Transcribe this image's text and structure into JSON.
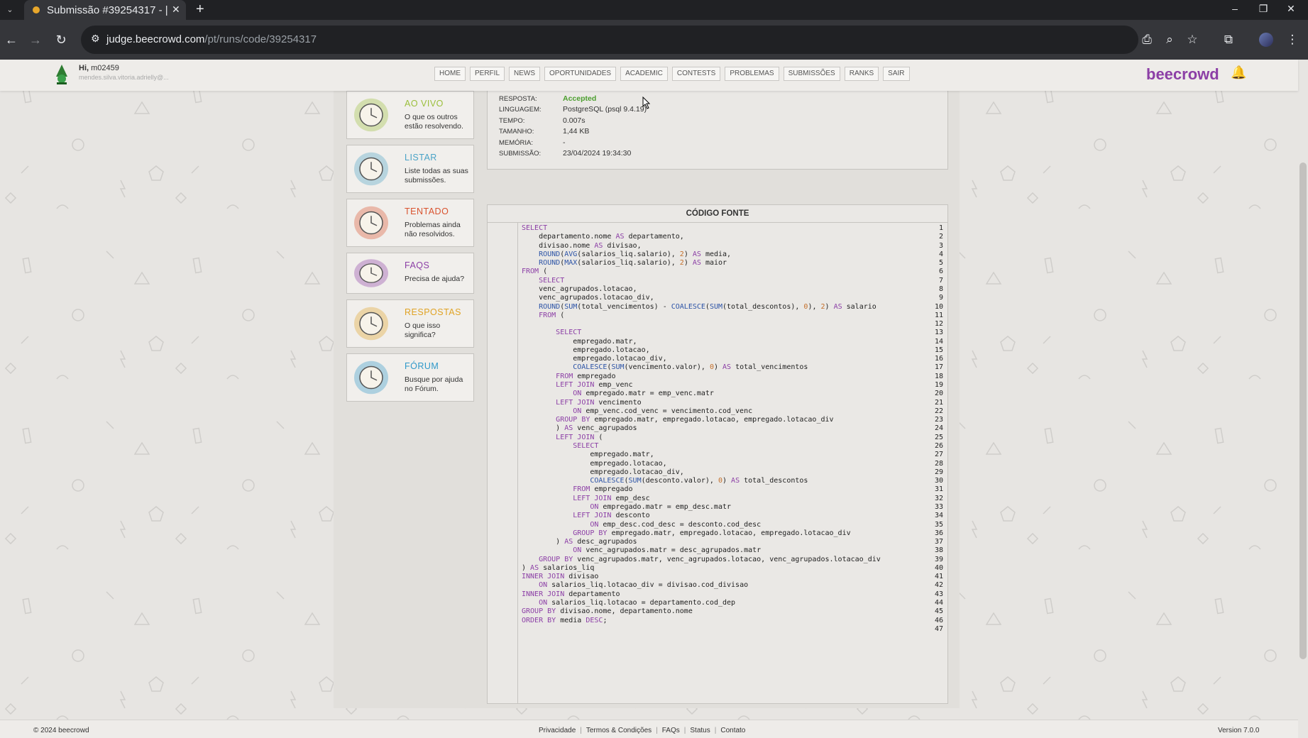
{
  "browser": {
    "tab_title": "Submissão #39254317 - |",
    "new_tab": "+",
    "url_host": "judge.beecrowd.com",
    "url_path": "/pt/runs/code/39254317"
  },
  "header": {
    "greeting": "Hi,",
    "username": "m02459",
    "email": "mendes.silva.vitoria.adrielly@...",
    "nav": [
      "HOME",
      "PERFIL",
      "NEWS",
      "OPORTUNIDADES",
      "ACADEMIC",
      "CONTESTS",
      "PROBLEMAS",
      "SUBMISSÕES",
      "RANKS",
      "SAIR"
    ],
    "brand": "beecrowd"
  },
  "sidebar": [
    {
      "title": "AO VIVO",
      "desc": "O que os outros estão resolvendo.",
      "color": "#9bbf3b",
      "icon": "globe-clock-icon"
    },
    {
      "title": "LISTAR",
      "desc": "Liste todas as suas submissões.",
      "color": "#4aa3c7",
      "icon": "papers-icon"
    },
    {
      "title": "TENTADO",
      "desc": "Problemas ainda não resolvidos.",
      "color": "#d9532f",
      "icon": "burning-box-icon"
    },
    {
      "title": "FAQS",
      "desc": "Precisa de ajuda?",
      "color": "#8c3fa6",
      "icon": "question-icon"
    },
    {
      "title": "RESPOSTAS",
      "desc": "O que isso significa?",
      "color": "#e0a324",
      "icon": "lightbulb-icon"
    },
    {
      "title": "FÓRUM",
      "desc": "Busque por ajuda no Fórum.",
      "color": "#2f98c9",
      "icon": "forum-icon"
    }
  ],
  "submission": {
    "rows": [
      {
        "label": "RESPOSTA:",
        "value": "Accepted"
      },
      {
        "label": "LINGUAGEM:",
        "value": "PostgreSQL (psql 9.4.19)"
      },
      {
        "label": "TEMPO:",
        "value": "0.007s"
      },
      {
        "label": "TAMANHO:",
        "value": "1,44 KB"
      },
      {
        "label": "MEMÓRIA:",
        "value": "-"
      },
      {
        "label": "SUBMISSÃO:",
        "value": "23/04/2024 19:34:30"
      }
    ]
  },
  "code": {
    "title": "CÓDIGO FONTE",
    "lines": [
      "SELECT",
      "    departamento.nome AS departamento,",
      "    divisao.nome AS divisao,",
      "    ROUND(AVG(salarios_liq.salario), 2) AS media,",
      "    ROUND(MAX(salarios_liq.salario), 2) AS maior",
      "FROM (",
      "    SELECT",
      "    venc_agrupados.lotacao,",
      "    venc_agrupados.lotacao_div,",
      "    ROUND(SUM(total_vencimentos) - COALESCE(SUM(total_descontos), 0), 2) AS salario",
      "    FROM (",
      "",
      "        SELECT",
      "            empregado.matr,",
      "            empregado.lotacao,",
      "            empregado.lotacao_div,",
      "            COALESCE(SUM(vencimento.valor), 0) AS total_vencimentos",
      "        FROM empregado",
      "        LEFT JOIN emp_venc",
      "            ON empregado.matr = emp_venc.matr",
      "        LEFT JOIN vencimento",
      "            ON emp_venc.cod_venc = vencimento.cod_venc",
      "        GROUP BY empregado.matr, empregado.lotacao, empregado.lotacao_div",
      "        ) AS venc_agrupados",
      "        LEFT JOIN (",
      "            SELECT",
      "                empregado.matr,",
      "                empregado.lotacao,",
      "                empregado.lotacao_div,",
      "                COALESCE(SUM(desconto.valor), 0) AS total_descontos",
      "            FROM empregado",
      "            LEFT JOIN emp_desc",
      "                ON empregado.matr = emp_desc.matr",
      "            LEFT JOIN desconto",
      "                ON emp_desc.cod_desc = desconto.cod_desc",
      "            GROUP BY empregado.matr, empregado.lotacao, empregado.lotacao_div",
      "        ) AS desc_agrupados",
      "            ON venc_agrupados.matr = desc_agrupados.matr",
      "    GROUP BY venc_agrupados.matr, venc_agrupados.lotacao, venc_agrupados.lotacao_div",
      ") AS salarios_liq",
      "INNER JOIN divisao",
      "    ON salarios_liq.lotacao_div = divisao.cod_divisao",
      "INNER JOIN departamento",
      "    ON salarios_liq.lotacao = departamento.cod_dep",
      "GROUP BY divisao.nome, departamento.nome",
      "ORDER BY media DESC;",
      ""
    ]
  },
  "footer": {
    "copyright": "© 2024 beecrowd",
    "links": [
      "Privacidade",
      "Termos & Condições",
      "FAQs",
      "Status",
      "Contato"
    ],
    "version": "Version 7.0.0"
  }
}
